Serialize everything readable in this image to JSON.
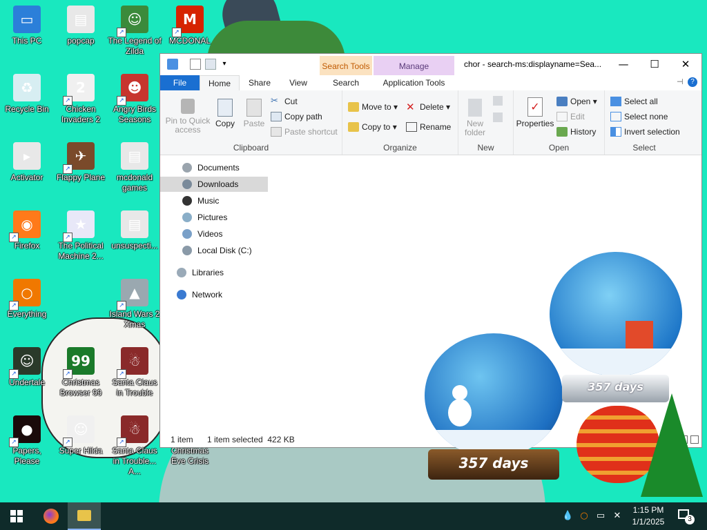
{
  "desktop": {
    "icons": [
      {
        "label": "This PC",
        "icon": "computer-icon",
        "color": "#2b7fd9",
        "glyph": "▭",
        "shortcut": false
      },
      {
        "label": "popcap",
        "icon": "folder-icon",
        "color": "#e8e8e8",
        "glyph": "▤",
        "shortcut": false
      },
      {
        "label": "The Legend of Zilda",
        "icon": "game-icon",
        "color": "#3b8a3b",
        "glyph": "☺",
        "shortcut": true
      },
      {
        "label": "MCDONAL",
        "icon": "mcdonalds-icon",
        "color": "#d62300",
        "glyph": "M",
        "shortcut": true
      },
      {
        "label": "Recycle Bin",
        "icon": "recycle-bin-icon",
        "color": "#d7eef2",
        "glyph": "♻",
        "shortcut": false
      },
      {
        "label": "Chicken Invaders 2",
        "icon": "chicken-icon",
        "color": "#f0f0f0",
        "glyph": "2",
        "shortcut": true
      },
      {
        "label": "Angry Birds Seasons",
        "icon": "angry-birds-icon",
        "color": "#c7352e",
        "glyph": "☻",
        "shortcut": true
      },
      {
        "label": "Activator",
        "icon": "file-icon",
        "color": "#e8e8e8",
        "glyph": "▸",
        "shortcut": false
      },
      {
        "label": "Flappy Plane",
        "icon": "plane-icon",
        "color": "#7a4a2a",
        "glyph": "✈",
        "shortcut": true
      },
      {
        "label": "mcdonald games",
        "icon": "file-icon",
        "color": "#e8e8e8",
        "glyph": "▤",
        "shortcut": false
      },
      {
        "label": "Firefox",
        "icon": "firefox-icon",
        "color": "#ff7a1a",
        "glyph": "◉",
        "shortcut": true
      },
      {
        "label": "The Political Machine 2...",
        "icon": "political-machine-icon",
        "color": "#e8e8f8",
        "glyph": "★",
        "shortcut": true
      },
      {
        "label": "unsuspecti...",
        "icon": "file-icon",
        "color": "#e8e8e8",
        "glyph": "▤",
        "shortcut": false
      },
      {
        "label": "Everything",
        "icon": "search-icon",
        "color": "#f07800",
        "glyph": "○",
        "shortcut": true
      },
      {
        "label": "Island Wars 2 Xmas",
        "icon": "island-wars-icon",
        "color": "#9aa8b0",
        "glyph": "▲",
        "shortcut": true
      },
      {
        "label": "Undertale",
        "icon": "undertale-icon",
        "color": "#2a3a2a",
        "glyph": "☺",
        "shortcut": true
      },
      {
        "label": "Christmas Browser 99",
        "icon": "christmas-tree-icon",
        "color": "#1a7a2a",
        "glyph": "99",
        "shortcut": true
      },
      {
        "label": "Santa Claus in Trouble",
        "icon": "santa-icon",
        "color": "#8a2a2a",
        "glyph": "☃",
        "shortcut": true
      },
      {
        "label": "Papers, Please",
        "icon": "papers-please-icon",
        "color": "#1a0a0a",
        "glyph": "●",
        "shortcut": true
      },
      {
        "label": "Super Hilda",
        "icon": "super-hilda-icon",
        "color": "#f0f0f0",
        "glyph": "☺",
        "shortcut": true
      },
      {
        "label": "Santa Claus in Trouble... A...",
        "icon": "santa-icon",
        "color": "#8a2a2a",
        "glyph": "☃",
        "shortcut": true
      },
      {
        "label": "Christmas Eve Crisis",
        "icon": "christmas-eve-icon",
        "color": "#19e8bf",
        "glyph": "",
        "shortcut": false
      }
    ]
  },
  "explorer": {
    "title": "chor - search-ms:displayname=Sea...",
    "context_headers": {
      "search": "Search Tools",
      "manage": "Manage"
    },
    "tabs": [
      "File",
      "Home",
      "Share",
      "View",
      "Search",
      "Application Tools"
    ],
    "ribbon": {
      "clipboard": {
        "label": "Clipboard",
        "pin": "Pin to Quick access",
        "copy": "Copy",
        "paste": "Paste",
        "cut": "Cut",
        "copy_path": "Copy path",
        "paste_shortcut": "Paste shortcut"
      },
      "organize": {
        "label": "Organize",
        "move_to": "Move to",
        "copy_to": "Copy to",
        "delete": "Delete",
        "rename": "Rename"
      },
      "new": {
        "label": "New",
        "new_folder": "New folder"
      },
      "open": {
        "label": "Open",
        "properties": "Properties",
        "open": "Open",
        "edit": "Edit",
        "history": "History"
      },
      "select": {
        "label": "Select",
        "select_all": "Select all",
        "select_none": "Select none",
        "invert": "Invert selection"
      }
    },
    "nav": [
      {
        "label": "Documents",
        "icon": "documents-icon",
        "selected": false
      },
      {
        "label": "Downloads",
        "icon": "downloads-icon",
        "selected": true
      },
      {
        "label": "Music",
        "icon": "music-icon",
        "selected": false
      },
      {
        "label": "Pictures",
        "icon": "pictures-icon",
        "selected": false
      },
      {
        "label": "Videos",
        "icon": "videos-icon",
        "selected": false
      },
      {
        "label": "Local Disk (C:)",
        "icon": "drive-icon",
        "selected": false
      },
      {
        "label": "Libraries",
        "icon": "libraries-icon",
        "selected": false
      },
      {
        "label": "Network",
        "icon": "network-icon",
        "selected": false
      }
    ],
    "status": {
      "count": "1 item",
      "selected": "1 item selected  422 KB"
    }
  },
  "widgets": {
    "countdown_1": "357 days",
    "countdown_2": "357 days"
  },
  "taskbar": {
    "time": "1:15 PM",
    "date": "1/1/2025",
    "notification_count": "3"
  },
  "colors": {
    "desktop_bg": "#19e8bf",
    "taskbar_bg": "#0f2b2a",
    "file_tab": "#1a6fd1"
  }
}
